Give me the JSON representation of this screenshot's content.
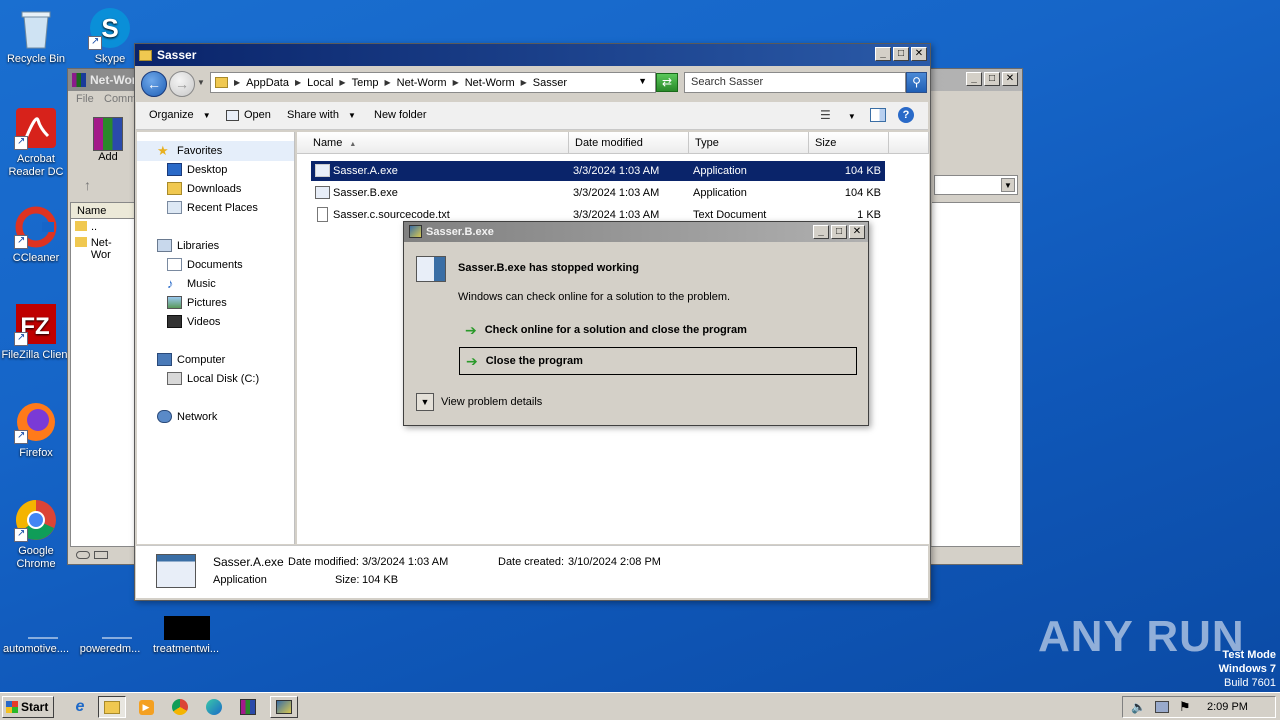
{
  "desktop": {
    "icons": [
      {
        "label": "Recycle Bin"
      },
      {
        "label": "Skype"
      },
      {
        "label": "Acrobat Reader DC"
      },
      {
        "label": "CCleaner"
      },
      {
        "label": "FileZilla Client"
      },
      {
        "label": "Firefox"
      },
      {
        "label": "Google Chrome"
      },
      {
        "label": "automotive...."
      },
      {
        "label": "poweredm..."
      },
      {
        "label": "treatmentwi..."
      }
    ],
    "watermark": "ANY RUN",
    "os_info": {
      "line1": "Test Mode",
      "line2": "Windows 7",
      "line3": "Build 7601"
    }
  },
  "bg_window": {
    "title": "Net-Wor",
    "menu": [
      "File",
      "Comm"
    ],
    "add_label": "Add",
    "col_name": "Name",
    "rows": [
      "..",
      "Net-Wor"
    ]
  },
  "explorer": {
    "title": "Sasser",
    "breadcrumbs": [
      "AppData",
      "Local",
      "Temp",
      "Net-Worm",
      "Net-Worm",
      "Sasser"
    ],
    "search_placeholder": "Search Sasser",
    "toolbar": {
      "organize": "Organize",
      "open": "Open",
      "share_with": "Share with",
      "new_folder": "New folder"
    },
    "nav": {
      "favorites": "Favorites",
      "desktop": "Desktop",
      "downloads": "Downloads",
      "recent": "Recent Places",
      "libraries": "Libraries",
      "documents": "Documents",
      "music": "Music",
      "pictures": "Pictures",
      "videos": "Videos",
      "computer": "Computer",
      "local_disk": "Local Disk (C:)",
      "network": "Network"
    },
    "columns": {
      "name": "Name",
      "date": "Date modified",
      "type": "Type",
      "size": "Size"
    },
    "files": [
      {
        "name": "Sasser.A.exe",
        "date": "3/3/2024 1:03 AM",
        "type": "Application",
        "size": "104 KB"
      },
      {
        "name": "Sasser.B.exe",
        "date": "3/3/2024 1:03 AM",
        "type": "Application",
        "size": "104 KB"
      },
      {
        "name": "Sasser.c.sourcecode.txt",
        "date": "3/3/2024 1:03 AM",
        "type": "Text Document",
        "size": "1 KB"
      }
    ],
    "details": {
      "name": "Sasser.A.exe",
      "kind": "Application",
      "date_modified_label": "Date modified:",
      "date_modified": "3/3/2024 1:03 AM",
      "date_created_label": "Date created:",
      "date_created": "3/10/2024 2:08 PM",
      "size_label": "Size:",
      "size": "104 KB"
    }
  },
  "dialog": {
    "title": "Sasser.B.exe",
    "heading": "Sasser.B.exe has stopped working",
    "message": "Windows can check online for a solution to the problem.",
    "option1": "Check online for a solution and close the program",
    "option2": "Close the program",
    "details": "View problem details"
  },
  "taskbar": {
    "start": "Start",
    "time": "2:09 PM"
  }
}
